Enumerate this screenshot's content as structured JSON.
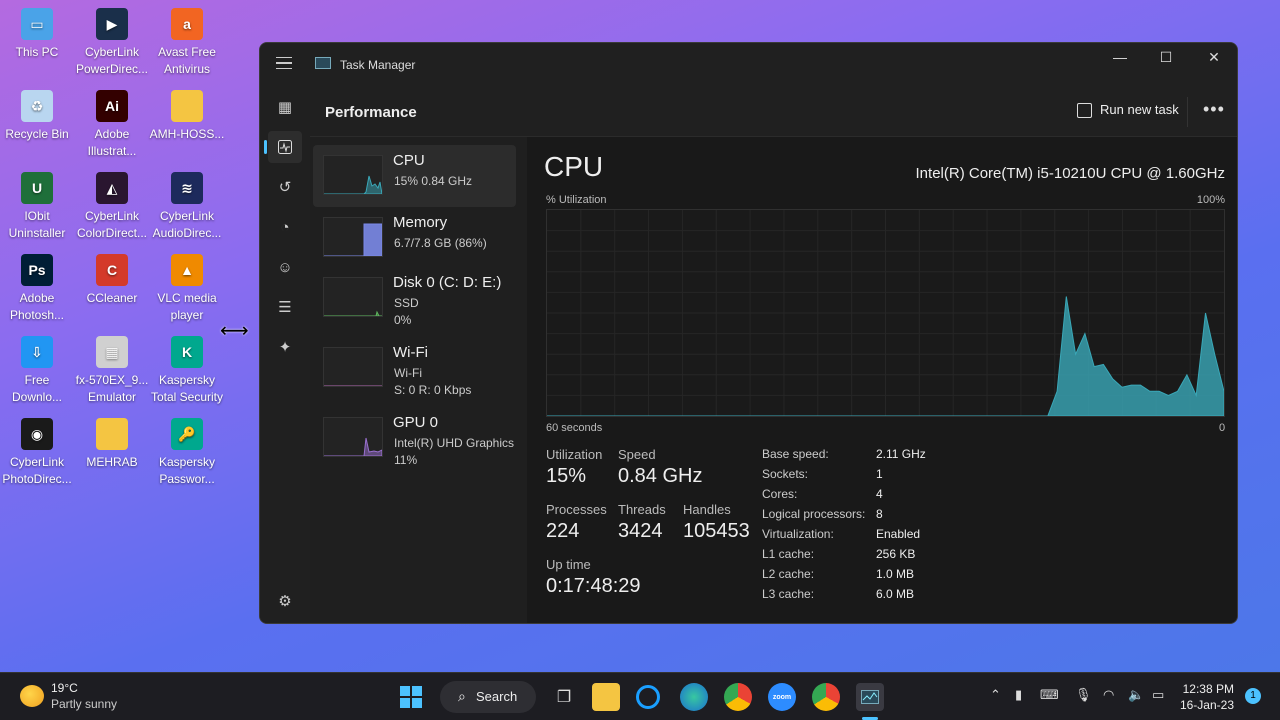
{
  "desktop": {
    "icons": [
      {
        "label": "This PC",
        "color": "#4aa3e8",
        "glyph": "▭"
      },
      {
        "label": "CyberLink PowerDirec...",
        "color": "#1a2f4a",
        "glyph": "▶"
      },
      {
        "label": "Avast Free Antivirus",
        "color": "#f26522",
        "glyph": "a"
      },
      {
        "label": "Recycle Bin",
        "color": "#b9d6f0",
        "glyph": "♻"
      },
      {
        "label": "Adobe Illustrat...",
        "color": "#330000",
        "glyph": "Ai"
      },
      {
        "label": "AMH-HOSS...",
        "color": "#f4c542",
        "glyph": ""
      },
      {
        "label": "IObit Uninstaller",
        "color": "#1f6f3a",
        "glyph": "U"
      },
      {
        "label": "CyberLink ColorDirect...",
        "color": "#2a1630",
        "glyph": "◭"
      },
      {
        "label": "CyberLink AudioDirec...",
        "color": "#1d2a5c",
        "glyph": "≋"
      },
      {
        "label": "Adobe Photosh...",
        "color": "#001e36",
        "glyph": "Ps"
      },
      {
        "label": "CCleaner",
        "color": "#d43a2a",
        "glyph": "C"
      },
      {
        "label": "VLC media player",
        "color": "#f08a00",
        "glyph": "▲"
      },
      {
        "label": "Free Downlo...",
        "color": "#2196f3",
        "glyph": "⇩"
      },
      {
        "label": "fx-570EX_9... Emulator",
        "color": "#d0d0d0",
        "glyph": "▦"
      },
      {
        "label": "Kaspersky Total Security",
        "color": "#00a88e",
        "glyph": "K"
      },
      {
        "label": "CyberLink PhotoDirec...",
        "color": "#1a1a1a",
        "glyph": "◉"
      },
      {
        "label": "MEHRAB",
        "color": "#f4c542",
        "glyph": ""
      },
      {
        "label": "Kaspersky Passwor...",
        "color": "#00a88e",
        "glyph": "🔑"
      }
    ]
  },
  "window": {
    "title": "Task Manager",
    "header": "Performance",
    "run_new_task": "Run new task",
    "more": "•••",
    "minimize": "—",
    "maximize": "☐",
    "close": "✕"
  },
  "sidebar_icons": [
    "processes-icon",
    "performance-icon",
    "app-history-icon",
    "startup-apps-icon",
    "users-icon",
    "details-icon",
    "services-icon",
    "settings-icon"
  ],
  "devices": [
    {
      "name": "CPU",
      "sub1": "15%  0.84 GHz",
      "sub2": "",
      "color": "#3aa8b8"
    },
    {
      "name": "Memory",
      "sub1": "6.7/7.8 GB (86%)",
      "sub2": "",
      "color": "#7b8ae8"
    },
    {
      "name": "Disk 0 (C: D: E:)",
      "sub1": "SSD",
      "sub2": "0%",
      "color": "#5fb85f"
    },
    {
      "name": "Wi-Fi",
      "sub1": "Wi-Fi",
      "sub2": "S: 0  R: 0 Kbps",
      "color": "#b06ab0"
    },
    {
      "name": "GPU 0",
      "sub1": "Intel(R) UHD Graphics",
      "sub2": "11%",
      "color": "#9a70d0"
    }
  ],
  "cpu": {
    "title": "CPU",
    "model": "Intel(R) Core(TM) i5-10210U CPU @ 1.60GHz",
    "util_label": "% Utilization",
    "max_label": "100%",
    "time_label": "60 seconds",
    "zero_label": "0",
    "stats": {
      "utilization_label": "Utilization",
      "utilization": "15%",
      "speed_label": "Speed",
      "speed": "0.84 GHz",
      "processes_label": "Processes",
      "processes": "224",
      "threads_label": "Threads",
      "threads": "3424",
      "handles_label": "Handles",
      "handles": "105453",
      "uptime_label": "Up time",
      "uptime": "0:17:48:29"
    },
    "specs": [
      {
        "k": "Base speed:",
        "v": "2.11 GHz"
      },
      {
        "k": "Sockets:",
        "v": "1"
      },
      {
        "k": "Cores:",
        "v": "4"
      },
      {
        "k": "Logical processors:",
        "v": "8"
      },
      {
        "k": "Virtualization:",
        "v": "Enabled"
      },
      {
        "k": "L1 cache:",
        "v": "256 KB"
      },
      {
        "k": "L2 cache:",
        "v": "1.0 MB"
      },
      {
        "k": "L3 cache:",
        "v": "6.0 MB"
      }
    ]
  },
  "chart_data": {
    "type": "area",
    "title": "",
    "xlabel": "60 seconds",
    "ylabel": "% Utilization",
    "ylim": [
      0,
      100
    ],
    "series": [
      {
        "values": [
          0,
          0,
          0,
          0,
          0,
          0,
          0,
          0,
          0,
          0,
          0,
          0,
          0,
          0,
          0,
          0,
          0,
          0,
          0,
          0,
          0,
          0,
          0,
          0,
          0,
          0,
          0,
          0,
          0,
          0,
          0,
          0,
          0,
          0,
          0,
          0,
          0,
          0,
          0,
          0,
          0,
          0,
          0,
          0,
          0,
          0,
          0,
          0,
          0,
          0,
          0,
          0,
          0,
          0,
          0,
          12,
          58,
          30,
          40,
          24,
          25,
          18,
          14,
          15,
          15,
          12,
          12,
          10,
          12,
          20,
          10,
          50,
          30,
          12
        ]
      }
    ],
    "color": "#3aa8b8"
  },
  "taskbar": {
    "weather_temp": "19°C",
    "weather_desc": "Partly sunny",
    "search": "Search",
    "time": "12:38 PM",
    "date": "16-Jan-23",
    "notif": "1"
  }
}
